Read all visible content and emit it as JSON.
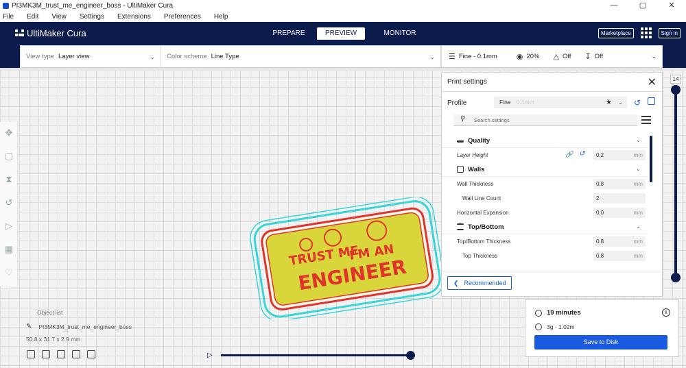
{
  "window": {
    "title": "PI3MK3M_trust_me_engineer_boss - UltiMaker Cura",
    "minimize": "—",
    "maximize": "▢",
    "close": "✕"
  },
  "menu": [
    "File",
    "Edit",
    "View",
    "Settings",
    "Extensions",
    "Preferences",
    "Help"
  ],
  "header": {
    "brand": "UltiMaker Cura",
    "tabs": {
      "prepare": "PREPARE",
      "preview": "PREVIEW",
      "monitor": "MONITOR"
    },
    "marketplace": "Marketplace",
    "signin": "Sign in"
  },
  "viewbar": {
    "view_type_label": "View type",
    "view_type_value": "Layer view",
    "color_scheme_label": "Color scheme",
    "color_scheme_value": "Line Type"
  },
  "settings_summary": {
    "profile": "Fine - 0.1mm",
    "infill": "20%",
    "support": "Off",
    "adhesion": "Off"
  },
  "layer_slider": {
    "max_layer": "14",
    "current_layer": "1"
  },
  "print_settings": {
    "title": "Print settings",
    "profile_label": "Profile",
    "profile_value": "Fine",
    "profile_suffix": "0.1mm",
    "search_placeholder": "Search settings",
    "categories": {
      "quality": "Quality",
      "walls": "Walls",
      "top_bottom": "Top/Bottom"
    },
    "rows": {
      "layer_height": {
        "label": "Layer Height",
        "value": "0.2",
        "unit": "mm"
      },
      "wall_thickness": {
        "label": "Wall Thickness",
        "value": "0.8",
        "unit": "mm"
      },
      "wall_line_count": {
        "label": "Wall Line Count",
        "value": "2"
      },
      "horizontal_expansion": {
        "label": "Horizontal Expansion",
        "value": "0.0",
        "unit": "mm"
      },
      "top_bottom_thickness": {
        "label": "Top/Bottom Thickness",
        "value": "0.8",
        "unit": "mm"
      },
      "top_thickness": {
        "label": "Top Thickness",
        "value": "0.8",
        "unit": "mm"
      }
    },
    "recommended_button": "Recommended"
  },
  "object_list": {
    "header": "Object list",
    "object_name": "PI3MK3M_trust_me_engineer_boss",
    "dimensions": "50.8 x 31.7 x 2.9 mm"
  },
  "model_text": {
    "line1": "TRUST ME",
    "line2": "I'M AN",
    "line3": "ENGINEER"
  },
  "estimate": {
    "time": "19 minutes",
    "material": "3g · 1.02m",
    "save_button": "Save to Disk"
  },
  "colors": {
    "header_bg": "#0b1c4c",
    "accent": "#1a5ae0",
    "infill_yellow": "#d8d63a",
    "wall_red": "#e0332c",
    "skirt_cyan": "#38d6d6"
  }
}
